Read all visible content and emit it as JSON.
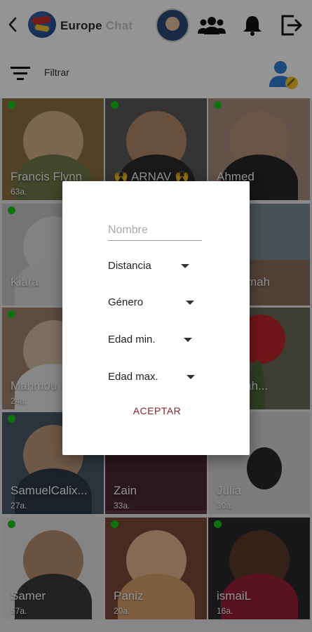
{
  "header": {
    "title_main": "Europe",
    "title_faded": "Chat",
    "icons": [
      "back-icon",
      "logo-globe-icon",
      "profile-avatar",
      "group-icon",
      "bell-icon",
      "logout-icon"
    ]
  },
  "filterbar": {
    "label": "Filtrar"
  },
  "grid": {
    "cards": [
      {
        "name": "Francis Flynn",
        "age": "63a.",
        "online": true
      },
      {
        "name": "🙌 ARNAV 🙌",
        "age": "",
        "online": true
      },
      {
        "name": "Ahmed",
        "age": "",
        "online": true
      },
      {
        "name": "Kiara",
        "age": "",
        "online": true
      },
      {
        "name": "",
        "age": "",
        "online": false
      },
      {
        "name": "mah",
        "age": "",
        "online": false
      },
      {
        "name": "Mahmou",
        "age": "24a.",
        "online": true
      },
      {
        "name": "",
        "age": "",
        "online": false
      },
      {
        "name": "mah...",
        "age": "",
        "online": false
      },
      {
        "name": "SamuelCalix...",
        "age": "27a.",
        "online": true
      },
      {
        "name": "Zain",
        "age": "33a.",
        "online": false
      },
      {
        "name": "Julia",
        "age": "30a.",
        "online": false
      },
      {
        "name": "Samer",
        "age": "57a.",
        "online": true
      },
      {
        "name": "Paniz",
        "age": "20a.",
        "online": true
      },
      {
        "name": "ismaiL",
        "age": "16a.",
        "online": true
      }
    ]
  },
  "dialog": {
    "name_placeholder": "Nombre",
    "distance_label": "Distancia",
    "gender_label": "Género",
    "age_min_label": "Edad min.",
    "age_max_label": "Edad max.",
    "accept_label": "ACEPTAR"
  },
  "colors": {
    "accent": "#8a2230",
    "online": "#19c719",
    "badge_blue": "#2f7fd6",
    "badge_yellow": "#f2c12e"
  }
}
